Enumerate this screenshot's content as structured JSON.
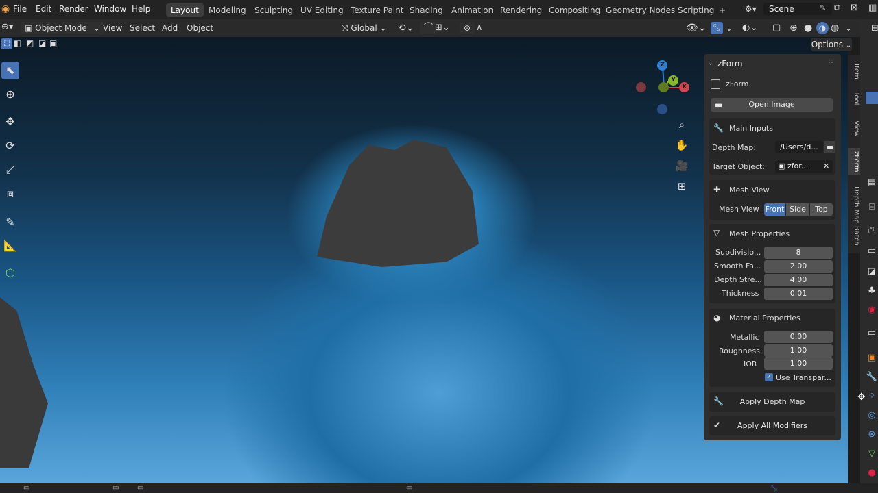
{
  "menu": {
    "items": [
      "File",
      "Edit",
      "Render",
      "Window",
      "Help"
    ]
  },
  "workspaces": {
    "tabs": [
      "Layout",
      "Modeling",
      "Sculpting",
      "UV Editing",
      "Texture Paint",
      "Shading",
      "Animation",
      "Rendering",
      "Compositing",
      "Geometry Nodes",
      "Scripting"
    ],
    "active": "Layout",
    "add_symbol": "+"
  },
  "scene": {
    "name": "Scene"
  },
  "header": {
    "mode": "Object Mode",
    "menus": [
      "View",
      "Select",
      "Add",
      "Object"
    ],
    "transform_orientation": "Global",
    "options_label": "Options"
  },
  "gizmo": {
    "z": "Z",
    "y": "Y",
    "x": "X"
  },
  "sidebar_tabs": [
    "Item",
    "Tool",
    "View",
    "zForm",
    "Depth Map Batch"
  ],
  "panel": {
    "title": "zForm",
    "enable_label": "zForm",
    "open_image_label": "Open Image",
    "main_inputs": {
      "title": "Main Inputs",
      "depth_map_label": "Depth Map:",
      "depth_map_value": "/Users/d...",
      "target_object_label": "Target Object:",
      "target_object_value": "zfor..."
    },
    "mesh_view": {
      "title": "Mesh View",
      "label": "Mesh View",
      "options": [
        "Front",
        "Side",
        "Top"
      ],
      "selected": "Front"
    },
    "mesh_properties": {
      "title": "Mesh Properties",
      "rows": [
        {
          "label": "Subdivisio...",
          "value": "8"
        },
        {
          "label": "Smooth Fa...",
          "value": "2.00"
        },
        {
          "label": "Depth Stre...",
          "value": "4.00"
        },
        {
          "label": "Thickness",
          "value": "0.01"
        }
      ]
    },
    "material_properties": {
      "title": "Material Properties",
      "rows": [
        {
          "label": "Metallic",
          "value": "0.00"
        },
        {
          "label": "Roughness",
          "value": "1.00"
        },
        {
          "label": "IOR",
          "value": "1.00"
        }
      ],
      "use_transparency_label": "Use Transpar...",
      "use_transparency_checked": true
    },
    "apply_depth_map_label": "Apply Depth Map",
    "apply_all_modifiers_label": "Apply All Modifiers"
  },
  "colors": {
    "accent": "#4772b3",
    "axis_x": "#d2454f",
    "axis_y": "#89b82a",
    "axis_z": "#2f7fd6"
  }
}
